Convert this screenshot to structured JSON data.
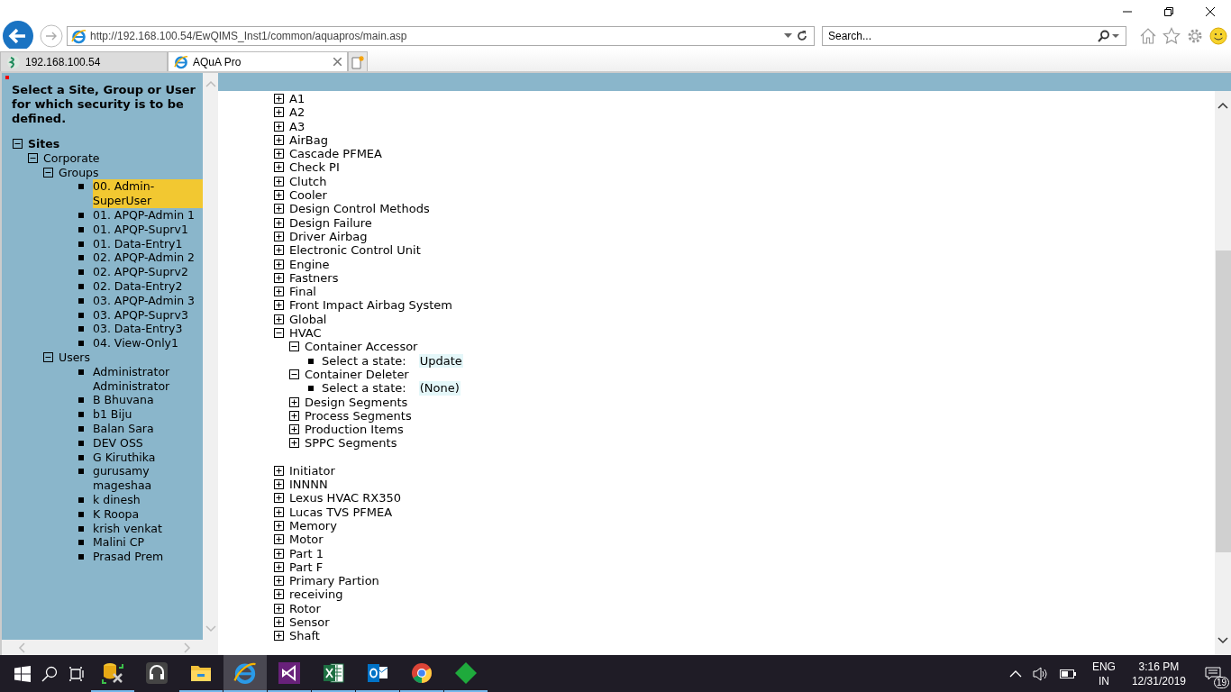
{
  "browser": {
    "address": "http://192.168.100.54/EwQIMS_Inst1/common/aquapros/main.asp",
    "search": {
      "placeholder": "Search..."
    },
    "tabs": [
      {
        "label": "192.168.100.54",
        "selected": false,
        "kind": "site"
      },
      {
        "label": "AQuA Pro",
        "selected": true,
        "kind": "ie"
      }
    ]
  },
  "left_pane": {
    "instruction": "Select a Site, Group or User for which security is to be defined.",
    "tree": [
      {
        "label": "Sites",
        "kind": "node",
        "expanded": true,
        "children": [
          {
            "label": "Corporate",
            "kind": "node",
            "expanded": true,
            "children": [
              {
                "label": "Groups",
                "kind": "node",
                "expanded": true,
                "children": [
                  {
                    "label": "00. Admin-SuperUser",
                    "kind": "leaf",
                    "selected": true
                  },
                  {
                    "label": "01. APQP-Admin 1",
                    "kind": "leaf",
                    "selected": false
                  },
                  {
                    "label": "01. APQP-Suprv1",
                    "kind": "leaf",
                    "selected": false
                  },
                  {
                    "label": "01. Data-Entry1",
                    "kind": "leaf",
                    "selected": false
                  },
                  {
                    "label": "02. APQP-Admin 2",
                    "kind": "leaf",
                    "selected": false
                  },
                  {
                    "label": "02. APQP-Suprv2",
                    "kind": "leaf",
                    "selected": false
                  },
                  {
                    "label": "02. Data-Entry2",
                    "kind": "leaf",
                    "selected": false
                  },
                  {
                    "label": "03. APQP-Admin 3",
                    "kind": "leaf",
                    "selected": false
                  },
                  {
                    "label": "03. APQP-Suprv3",
                    "kind": "leaf",
                    "selected": false
                  },
                  {
                    "label": "03. Data-Entry3",
                    "kind": "leaf",
                    "selected": false
                  },
                  {
                    "label": "04. View-Only1",
                    "kind": "leaf",
                    "selected": false
                  }
                ]
              },
              {
                "label": "Users",
                "kind": "node",
                "expanded": true,
                "children": [
                  {
                    "label": "Administrator Administrator",
                    "kind": "leaf",
                    "selected": false
                  },
                  {
                    "label": "B Bhuvana",
                    "kind": "leaf",
                    "selected": false
                  },
                  {
                    "label": "b1 Biju",
                    "kind": "leaf",
                    "selected": false
                  },
                  {
                    "label": "Balan Sara",
                    "kind": "leaf",
                    "selected": false
                  },
                  {
                    "label": "DEV OSS",
                    "kind": "leaf",
                    "selected": false
                  },
                  {
                    "label": "G Kiruthika",
                    "kind": "leaf",
                    "selected": false
                  },
                  {
                    "label": "gurusamy mageshaa",
                    "kind": "leaf",
                    "selected": false
                  },
                  {
                    "label": "k dinesh",
                    "kind": "leaf",
                    "selected": false
                  },
                  {
                    "label": "K Roopa",
                    "kind": "leaf",
                    "selected": false
                  },
                  {
                    "label": "krish venkat",
                    "kind": "leaf",
                    "selected": false
                  },
                  {
                    "label": "Malini CP",
                    "kind": "leaf",
                    "selected": false
                  },
                  {
                    "label": "Prasad Prem",
                    "kind": "leaf",
                    "selected": false
                  }
                ]
              }
            ]
          }
        ]
      }
    ]
  },
  "right_pane": {
    "tree": [
      {
        "label": "A1",
        "kind": "node",
        "expanded": false
      },
      {
        "label": "A2",
        "kind": "node",
        "expanded": false
      },
      {
        "label": "A3",
        "kind": "node",
        "expanded": false
      },
      {
        "label": "AirBag",
        "kind": "node",
        "expanded": false
      },
      {
        "label": "Cascade PFMEA",
        "kind": "node",
        "expanded": false
      },
      {
        "label": "Check PI",
        "kind": "node",
        "expanded": false
      },
      {
        "label": "Clutch",
        "kind": "node",
        "expanded": false
      },
      {
        "label": "Cooler",
        "kind": "node",
        "expanded": false
      },
      {
        "label": "Design Control Methods",
        "kind": "node",
        "expanded": false
      },
      {
        "label": "Design Failure",
        "kind": "node",
        "expanded": false
      },
      {
        "label": "Driver Airbag",
        "kind": "node",
        "expanded": false
      },
      {
        "label": "Electronic Control Unit",
        "kind": "node",
        "expanded": false
      },
      {
        "label": "Engine",
        "kind": "node",
        "expanded": false
      },
      {
        "label": "Fastners",
        "kind": "node",
        "expanded": false
      },
      {
        "label": "Final",
        "kind": "node",
        "expanded": false
      },
      {
        "label": "Front Impact Airbag System",
        "kind": "node",
        "expanded": false
      },
      {
        "label": "Global",
        "kind": "node",
        "expanded": false
      },
      {
        "label": "HVAC",
        "kind": "node",
        "expanded": true,
        "children": [
          {
            "label": "Container Accessor",
            "kind": "node",
            "expanded": true,
            "children": [
              {
                "label": "Select a state:",
                "kind": "state",
                "value": "Update"
              }
            ]
          },
          {
            "label": "Container Deleter",
            "kind": "node",
            "expanded": true,
            "children": [
              {
                "label": "Select a state:",
                "kind": "state",
                "value": "(None)"
              }
            ]
          },
          {
            "label": "Design Segments",
            "kind": "node",
            "expanded": false
          },
          {
            "label": "Process Segments",
            "kind": "node",
            "expanded": false
          },
          {
            "label": "Production Items",
            "kind": "node",
            "expanded": false
          },
          {
            "label": "SPPC Segments",
            "kind": "node",
            "expanded": false
          }
        ]
      },
      {
        "label": "Initiator",
        "kind": "node",
        "expanded": false
      },
      {
        "label": "INNNN",
        "kind": "node",
        "expanded": false
      },
      {
        "label": "Lexus HVAC RX350",
        "kind": "node",
        "expanded": false
      },
      {
        "label": "Lucas TVS PFMEA",
        "kind": "node",
        "expanded": false
      },
      {
        "label": "Memory",
        "kind": "node",
        "expanded": false
      },
      {
        "label": "Motor",
        "kind": "node",
        "expanded": false
      },
      {
        "label": "Part 1",
        "kind": "node",
        "expanded": false
      },
      {
        "label": "Part F",
        "kind": "node",
        "expanded": false
      },
      {
        "label": "Primary Partion",
        "kind": "node",
        "expanded": false
      },
      {
        "label": "receiving",
        "kind": "node",
        "expanded": false
      },
      {
        "label": "Rotor",
        "kind": "node",
        "expanded": false
      },
      {
        "label": "Sensor",
        "kind": "node",
        "expanded": false
      },
      {
        "label": "Shaft",
        "kind": "node",
        "expanded": false
      }
    ]
  },
  "taskbar": {
    "apps": [
      {
        "kind": "database",
        "selected": false,
        "running": true
      },
      {
        "kind": "headphones",
        "selected": false,
        "running": false
      },
      {
        "kind": "folder",
        "selected": false,
        "running": true
      },
      {
        "kind": "ie",
        "selected": true,
        "running": true
      },
      {
        "kind": "studio",
        "selected": false,
        "running": true
      },
      {
        "kind": "excel",
        "selected": false,
        "running": true
      },
      {
        "kind": "outlook",
        "selected": false,
        "running": true
      },
      {
        "kind": "chrome",
        "selected": false,
        "running": true
      },
      {
        "kind": "diamond",
        "selected": false,
        "running": true
      }
    ],
    "language": "ENG",
    "region": "IN",
    "time": "3:16 PM",
    "date": "12/31/2019",
    "notifications": "19"
  }
}
